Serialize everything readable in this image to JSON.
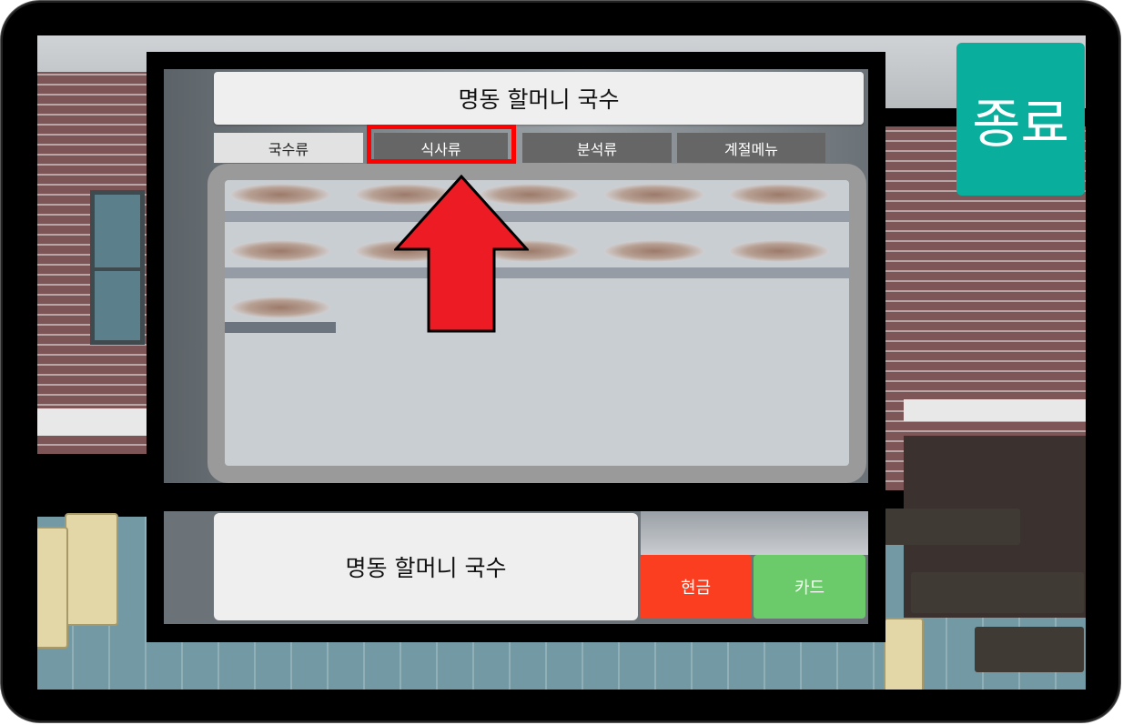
{
  "kiosk": {
    "title": "명동 할머니 국수",
    "tabs": [
      {
        "label": "국수류",
        "active": true
      },
      {
        "label": "식사류",
        "active": false
      },
      {
        "label": "분석류",
        "active": false
      },
      {
        "label": "계절메뉴",
        "active": false
      }
    ],
    "order_title": "명동 할머니 국수",
    "cash_label": "현금",
    "card_label": "카드"
  },
  "exit_label": "종료",
  "colors": {
    "exit": "#0aae9d",
    "cash": "#fa3e1f",
    "card": "#6bcb6a",
    "highlight": "#ff0000",
    "arrow": "#ed1c24"
  },
  "icons": {
    "pointer": "up-arrow-icon"
  }
}
